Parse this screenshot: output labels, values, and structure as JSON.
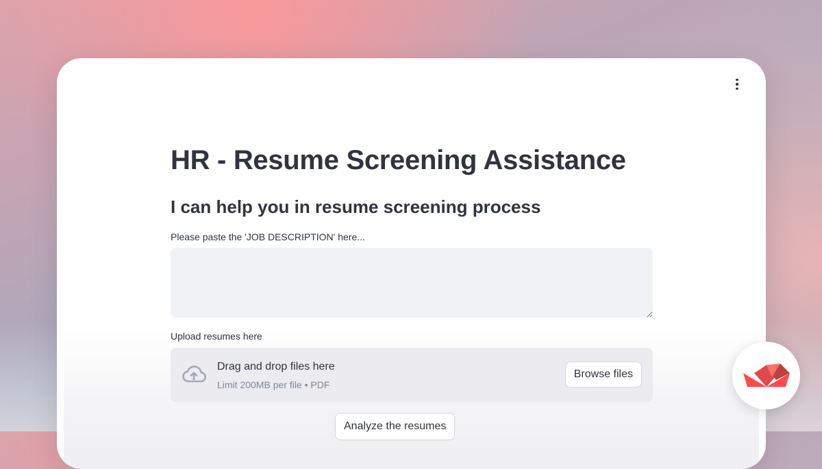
{
  "app": {
    "title": "HR - Resume Screening Assistance",
    "subtitle": "I can help you in resume screening process"
  },
  "job_description": {
    "label": "Please paste the 'JOB DESCRIPTION' here...",
    "value": ""
  },
  "upload": {
    "label": "Upload resumes here",
    "drop_text": "Drag and drop files here",
    "limit_text": "Limit 200MB per file • PDF",
    "browse_label": "Browse files"
  },
  "actions": {
    "analyze_label": "Analyze the resumes"
  },
  "icons": {
    "menu": "vertical-dots-icon",
    "upload": "cloud-upload-icon",
    "logo": "streamlit-logo-icon"
  },
  "colors": {
    "text": "#31333f",
    "muted_text": "#808495",
    "input_bg": "#f0f2f6",
    "dropzone_bg": "#ececf0",
    "logo_red": "#ff4b4b",
    "logo_dark_red": "#bd4043"
  }
}
